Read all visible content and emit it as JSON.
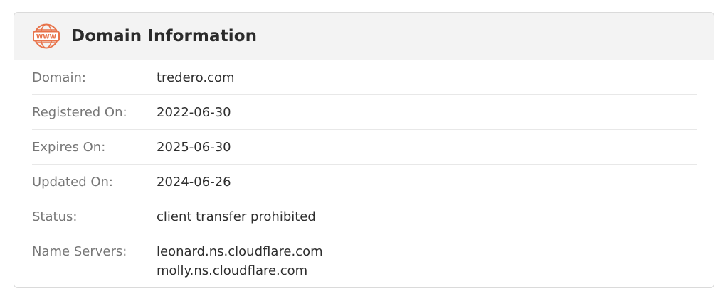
{
  "card": {
    "title": "Domain Information",
    "icon": "www-globe-icon",
    "accent_color": "#e8734a"
  },
  "rows": {
    "domain": {
      "label": "Domain:",
      "value": "tredero.com"
    },
    "registered": {
      "label": "Registered On:",
      "value": "2022-06-30"
    },
    "expires": {
      "label": "Expires On:",
      "value": "2025-06-30"
    },
    "updated": {
      "label": "Updated On:",
      "value": "2024-06-26"
    },
    "status": {
      "label": "Status:",
      "value": "client transfer prohibited"
    },
    "name_servers": {
      "label": "Name Servers:",
      "values": [
        "leonard.ns.cloudflare.com",
        "molly.ns.cloudflare.com"
      ]
    }
  }
}
